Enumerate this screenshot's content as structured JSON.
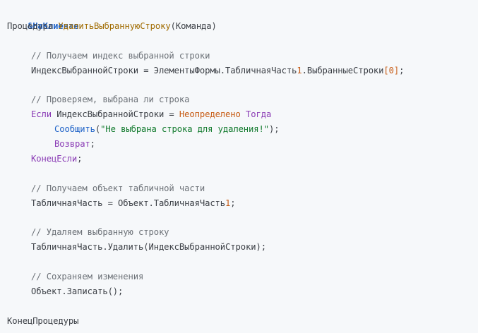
{
  "code": {
    "directive": "&НаКлиенте",
    "proc_keyword": "Процедура",
    "proc_name": "УдалитьВыбраннуюСтроку",
    "proc_params": "(Команда)",
    "comment1": "// Получаем индекс выбранной строки",
    "line_index_a": "ИндексВыбраннойСтроки = ЭлементыФормы.ТабличнаяЧасть",
    "line_index_num": "1",
    "line_index_b": ".ВыбранныеСтроки",
    "line_index_open": "[",
    "line_index_zero": "0",
    "line_index_close": "]",
    "line_index_end": ";",
    "comment2": "// Проверяем, выбрана ли строка",
    "if_kw": "Если",
    "if_mid": " ИндексВыбраннойСтроки = ",
    "if_undef": "Неопределено",
    "if_then": " Тогда",
    "msg_func": "Сообщить",
    "msg_open": "(",
    "msg_string": "\"Не выбрана строка для удаления!\"",
    "msg_close": ");",
    "return_kw": "Возврат",
    "return_end": ";",
    "endif_kw": "КонецЕсли",
    "endif_end": ";",
    "comment3": "// Получаем объект табличной части",
    "line_tab_a": "ТабличнаяЧасть = Объект.ТабличнаяЧасть",
    "line_tab_num": "1",
    "line_tab_end": ";",
    "comment4": "// Удаляем выбранную строку",
    "line_delete": "ТабличнаяЧасть.Удалить(ИндексВыбраннойСтроки);",
    "comment5": "// Сохраняем изменения",
    "line_write": "Объект.Записать();",
    "end_proc": "КонецПроцедуры"
  }
}
